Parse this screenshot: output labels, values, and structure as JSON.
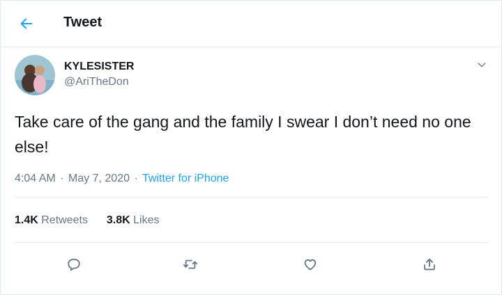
{
  "header": {
    "title": "Tweet",
    "back_icon": "arrow-left-icon"
  },
  "colors": {
    "accent": "#1da1f2",
    "text_primary": "#14171a",
    "text_secondary": "#657786",
    "divider": "#e6ecf0"
  },
  "tweet": {
    "author": {
      "display_name": "KYLESISTER",
      "handle": "@AriTheDon"
    },
    "text": "Take care of the gang and the family I swear I don’t need no one else!",
    "time": "4:04 AM",
    "date": "May 7, 2020",
    "source": "Twitter for iPhone",
    "separator": "·"
  },
  "stats": {
    "retweets_count": "1.4K",
    "retweets_label": "Retweets",
    "likes_count": "3.8K",
    "likes_label": "Likes"
  },
  "actions": [
    {
      "icon": "reply-icon"
    },
    {
      "icon": "retweet-icon"
    },
    {
      "icon": "like-icon"
    },
    {
      "icon": "share-icon"
    }
  ]
}
